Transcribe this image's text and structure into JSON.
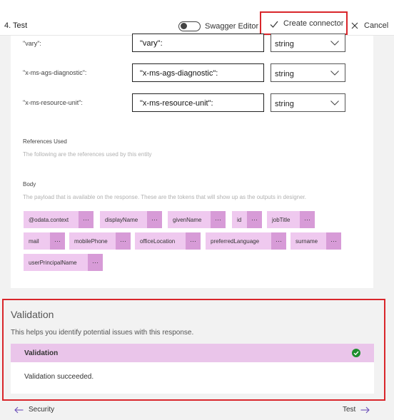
{
  "header": {
    "step_title": "4. Test",
    "swagger_toggle_label": "Swagger Editor",
    "swagger_toggle_on": false,
    "create_connector_label": "Create connector",
    "cancel_label": "Cancel"
  },
  "headers": [
    {
      "key": "\"vary\":",
      "value": "\"vary\":",
      "type": "string"
    },
    {
      "key": "\"x-ms-ags-diagnostic\":",
      "value": "\"x-ms-ags-diagnostic\":",
      "type": "string"
    },
    {
      "key": "\"x-ms-resource-unit\":",
      "value": "\"x-ms-resource-unit\":",
      "type": "string"
    }
  ],
  "references": {
    "title": "References Used",
    "description": "The following are the references used by this entity"
  },
  "body": {
    "title": "Body",
    "description": "The payload that is available on the response. These are the tokens that will show up as the outputs in designer.",
    "more_label": "···",
    "tokens": [
      "@odata.context",
      "displayName",
      "givenName",
      "id",
      "jobTitle",
      "mail",
      "mobilePhone",
      "officeLocation",
      "preferredLanguage",
      "surname",
      "userPrincipalName"
    ]
  },
  "validation": {
    "title": "Validation",
    "description": "This helps you identify potential issues with this response.",
    "bar_label": "Validation",
    "result": "Validation succeeded."
  },
  "nav": {
    "back_label": "Security",
    "next_label": "Test"
  },
  "colors": {
    "highlight_border": "#d9262b",
    "token_bg": "#efc9ef",
    "token_more_bg": "#d79bd7",
    "success": "#1e8e2e"
  }
}
